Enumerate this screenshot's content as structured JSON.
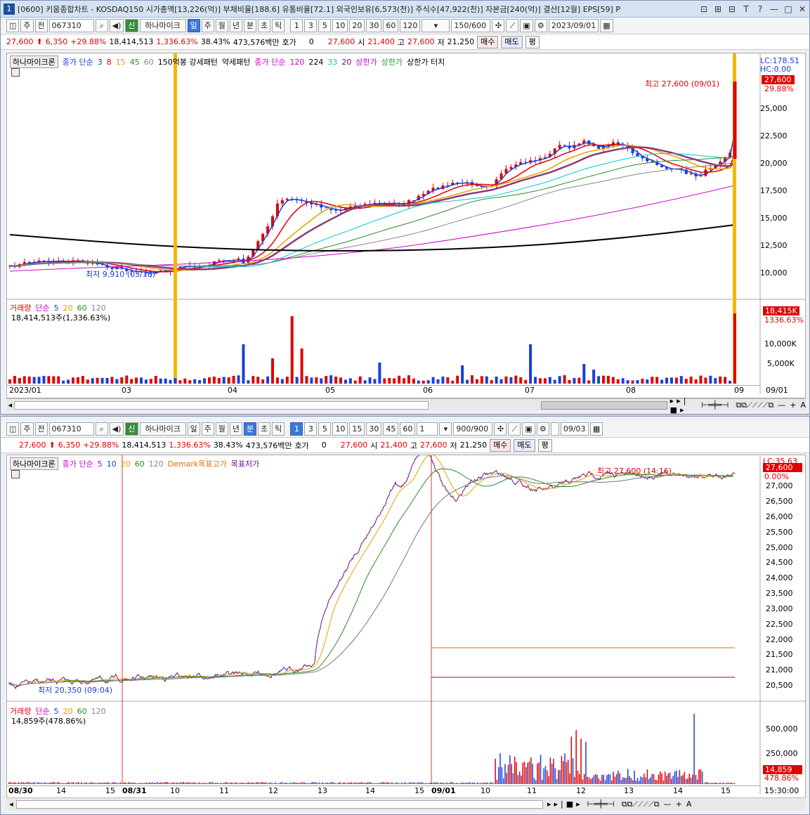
{
  "window1": {
    "title_num": "1",
    "title": "[0600] 키움종합차트 - KOSDAQ150 시가총액[13,226(억)] 부채비율[188.6] 유통비율[72.1] 외국인보유[6,573(천)] 주식수[47,922(천)] 자본금[240(억)] 결산[12월] EPS[59] P",
    "title_buttons": [
      "⊡",
      "⊞",
      "⊟",
      "T",
      "?",
      "—",
      "□",
      "✕"
    ],
    "toolbar": {
      "type": "주",
      "range": "전",
      "code": "067310",
      "name": "하나마이크",
      "periods": [
        "일",
        "주",
        "월",
        "년",
        "분",
        "초",
        "틱"
      ],
      "active_period": "일",
      "numbers": [
        "1",
        "3",
        "5",
        "10",
        "20",
        "30",
        "60",
        "120"
      ],
      "count": "150/600",
      "date": "2023/09/01"
    },
    "quote": {
      "price": "27,600",
      "change": "6,350",
      "pct": "+29.88%",
      "volume": "18,414,513",
      "vol_pct": "1,336.63%",
      "turnover": "38.43%",
      "amount": "473,576백만",
      "hoga_label": "호가",
      "hoga": "0",
      "price2": "27,600",
      "open_label": "시",
      "open": "21,400",
      "high_label": "고",
      "high": "27,600",
      "low_label": "저",
      "low": "21,250",
      "buy": "매수",
      "sell": "매도",
      "flat": "평"
    },
    "legend": [
      "하나마이크론",
      "종가 단순",
      "3",
      "8",
      "15",
      "45",
      "60",
      "150억봉 강세패턴",
      "약세패턴",
      "종가 단순",
      "120",
      "224",
      "33",
      "20",
      "상한가",
      "상한가",
      "상한가 터치"
    ],
    "lc": "LC:178.51",
    "hc": "HC:0.00",
    "price_tag": "27,600",
    "pct_tag": "29.88%",
    "high_note": "최고 27,600 (09/01)",
    "low_note": "최저 9,910 (03/16)",
    "y_ticks": [
      "25,000",
      "22,500",
      "20,000",
      "17,500",
      "15,000",
      "12,500",
      "10,000"
    ],
    "vol_legend": [
      "거래량",
      "단순",
      "5",
      "20",
      "60",
      "120"
    ],
    "vol_note": "18,414,513주(1,336.63%)",
    "vol_tag": "18,415K",
    "vol_pct_tag": "1336.63%",
    "vol_ticks": [
      "10,000K",
      "5,000K"
    ],
    "x_ticks": [
      "2023/01",
      "03",
      "04",
      "05",
      "06",
      "07",
      "08",
      "09",
      "09/01"
    ]
  },
  "window2": {
    "toolbar": {
      "type": "주",
      "range": "전",
      "code": "067310",
      "name": "하나마이크",
      "periods": [
        "일",
        "주",
        "월",
        "년",
        "분",
        "초",
        "틱"
      ],
      "active_period": "분",
      "numbers": [
        "1",
        "3",
        "5",
        "10",
        "15",
        "30",
        "45",
        "60"
      ],
      "interval": "1",
      "count": "900/900",
      "date": "09/03"
    },
    "quote": {
      "price": "27,600",
      "change": "6,350",
      "pct": "+29.88%",
      "volume": "18,414,513",
      "vol_pct": "1,336.63%",
      "turnover": "38.43%",
      "amount": "473,576백만",
      "hoga_label": "호가",
      "hoga": "0",
      "price2": "27,600",
      "open_label": "시",
      "open": "21,400",
      "high_label": "고",
      "high": "27,600",
      "low_label": "저",
      "low": "21,250",
      "buy": "매수",
      "sell": "매도",
      "flat": "평"
    },
    "legend": [
      "하나마이크론",
      "종가 단순",
      "5",
      "10",
      "20",
      "60",
      "120",
      "Demark목표고가",
      "목표저가"
    ],
    "lc": "LC:35.63",
    "price_tag": "27,600",
    "pct_tag": "0.00%",
    "high_note": "최고 27,600 (14:16)",
    "low_note": "최저 20,350 (09:04)",
    "y_ticks": [
      "27,000",
      "26,500",
      "26,000",
      "25,500",
      "25,000",
      "24,500",
      "24,000",
      "23,500",
      "23,000",
      "22,500",
      "22,000",
      "21,500",
      "21,000",
      "20,500"
    ],
    "vol_legend": [
      "거래량",
      "단순",
      "5",
      "20",
      "60",
      "120"
    ],
    "vol_note": "14,859주(478.86%)",
    "vol_tag": "14,859",
    "vol_pct_tag": "478.86%",
    "vol_ticks": [
      "500,000",
      "250,000"
    ],
    "x_ticks": [
      "08/30",
      "14",
      "15",
      "08/31",
      "10",
      "11",
      "12",
      "13",
      "14",
      "15",
      "09/01",
      "10",
      "11",
      "12",
      "13",
      "14",
      "15"
    ],
    "time": "15:30:00"
  },
  "colors": {
    "up": "#e00000",
    "down": "#1a3fd8",
    "highlight": "#f5b800"
  }
}
